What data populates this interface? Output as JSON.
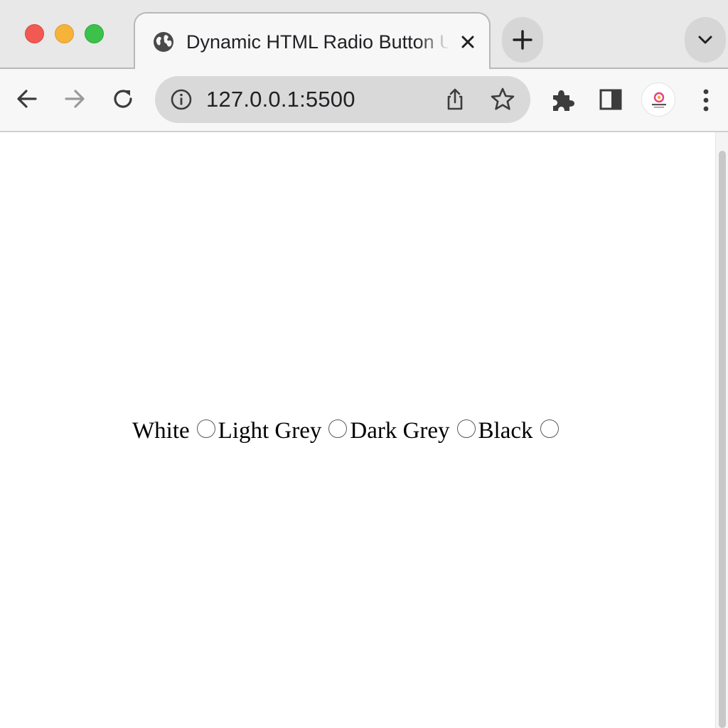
{
  "browser": {
    "tab": {
      "title": "Dynamic HTML Radio Button U"
    },
    "address_bar": {
      "url": "127.0.0.1:5500"
    }
  },
  "page": {
    "radio_group": {
      "options": [
        {
          "label": "White"
        },
        {
          "label": "Light Grey"
        },
        {
          "label": "Dark Grey"
        },
        {
          "label": "Black"
        }
      ]
    }
  },
  "colors": {
    "close_red": "#f05a52",
    "minimize_yellow": "#f6b33a",
    "maximize_green": "#3cc24a",
    "chrome_background": "#e8e8e8",
    "omnibox_background": "#d9d9d9"
  },
  "icons": {
    "favicon": "globe-icon",
    "close_tab": "close-icon",
    "new_tab": "plus-icon",
    "tab_search": "chevron-down-icon",
    "back": "arrow-left-icon",
    "forward": "arrow-right-icon",
    "reload": "reload-icon",
    "site_info": "info-icon",
    "share": "share-icon",
    "bookmark": "star-icon",
    "extensions": "puzzle-icon",
    "side_panel": "side-panel-icon",
    "profile": "avatar",
    "menu": "kebab-menu-icon"
  }
}
